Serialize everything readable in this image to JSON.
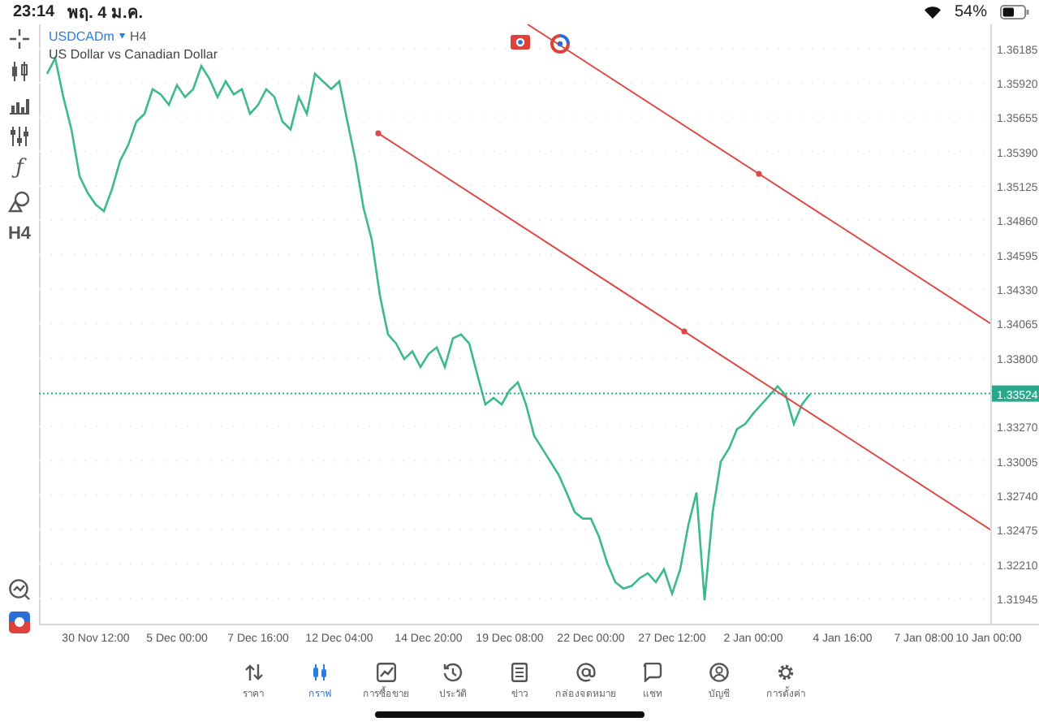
{
  "status_bar": {
    "time": "23:14",
    "date": "พฤ. 4 ม.ค.",
    "battery_text": "54%",
    "battery": {
      "level": 0.54
    }
  },
  "toolbar": {
    "function_label": "ƒ",
    "timeframe": "H4"
  },
  "chart_header": {
    "symbol": "USDCADm",
    "caret": "▾",
    "timeframe": "H4",
    "description": "US Dollar vs Canadian Dollar"
  },
  "chart": {
    "drawings": [
      {
        "kind": "trend_line"
      },
      {
        "kind": "trend_line"
      }
    ],
    "current_price": "1.33524",
    "chart_data": {
      "type": "line",
      "grid": true,
      "categories": [
        null,
        null,
        null,
        null,
        null,
        null,
        null,
        "30 Nov 12:00",
        null,
        null,
        null,
        null,
        null,
        null,
        null,
        null,
        null,
        "5 Dec 00:00",
        null,
        null,
        null,
        null,
        null,
        null,
        null,
        null,
        null,
        "7 Dec 16:00",
        null,
        null,
        null,
        null,
        null,
        null,
        null,
        null,
        null,
        "12 Dec 04:00",
        null,
        null,
        null,
        null,
        null,
        null,
        null,
        null,
        null,
        null,
        "14 Dec 20:00",
        null,
        null,
        null,
        null,
        null,
        null,
        null,
        null,
        null,
        "19 Dec 08:00",
        null,
        null,
        null,
        null,
        null,
        null,
        null,
        null,
        null,
        "22 Dec 00:00",
        null,
        null,
        null,
        null,
        null,
        null,
        null,
        null,
        null,
        "27 Dec 12:00",
        null,
        null,
        null,
        null,
        null,
        null,
        null,
        null,
        null,
        "2 Jan 00:00",
        null,
        null,
        null,
        null,
        null,
        null,
        null,
        null,
        null,
        null,
        "4 Jan 16:00",
        null,
        null,
        null,
        null,
        null,
        null,
        null,
        null,
        null,
        "7 Jan 08:00",
        null,
        null,
        null,
        null,
        null,
        null,
        null,
        "10 Jan 00:00"
      ],
      "series": [
        {
          "color": "#3dba8c",
          "values": [
            null,
            1.3599,
            1.3611,
            1.3581,
            1.3556,
            1.352,
            1.3507,
            1.3498,
            1.3493,
            1.351,
            1.3532,
            1.3544,
            1.3562,
            1.3568,
            1.3587,
            1.3583,
            1.3575,
            1.359,
            1.3581,
            1.3587,
            1.3605,
            1.3595,
            1.3581,
            1.3593,
            1.3583,
            1.3587,
            1.3568,
            1.3575,
            1.3587,
            1.3581,
            1.3562,
            1.3556,
            1.3581,
            1.3568,
            1.3599,
            1.3593,
            1.3587,
            1.3593,
            1.3562,
            1.3532,
            1.3495,
            1.3471,
            1.3428,
            1.3398,
            1.3391,
            1.3379,
            1.3385,
            1.3373,
            1.3383,
            1.3388,
            1.3373,
            1.3395,
            1.3398,
            1.3391,
            1.3367,
            1.3344,
            1.3349,
            1.3344,
            1.3355,
            1.3361,
            1.3344,
            1.332,
            1.331,
            1.33,
            1.329,
            1.3276,
            1.3261,
            1.3256,
            1.3256,
            1.3242,
            1.3222,
            1.3207,
            1.3202,
            1.3204,
            1.321,
            1.3214,
            1.3207,
            1.3217,
            1.3198,
            1.3217,
            1.3251,
            1.3276,
            1.3193,
            1.3261,
            1.33,
            1.331,
            1.3325,
            1.3329,
            1.3337,
            1.3344,
            1.3351,
            1.3358,
            1.3351,
            1.3329,
            1.3344,
            1.3352,
            null,
            null,
            null,
            null,
            null,
            null,
            null,
            null,
            null,
            null,
            null,
            null,
            null,
            null,
            null,
            null,
            null,
            null,
            null,
            null,
            null,
            null
          ]
        }
      ],
      "ylim": [
        1.3175,
        1.3637
      ],
      "yticks": [
        {
          "value": 1.36185,
          "label": "1.36185"
        },
        {
          "value": 1.3592,
          "label": "1.35920"
        },
        {
          "value": 1.35655,
          "label": "1.35655"
        },
        {
          "value": 1.3539,
          "label": "1.35390"
        },
        {
          "value": 1.35125,
          "label": "1.35125"
        },
        {
          "value": 1.3486,
          "label": "1.34860"
        },
        {
          "value": 1.34595,
          "label": "1.34595"
        },
        {
          "value": 1.3433,
          "label": "1.34330"
        },
        {
          "value": 1.34065,
          "label": "1.34065"
        },
        {
          "value": 1.338,
          "label": "1.33800"
        },
        {
          "value": 1.3327,
          "label": "1.33270"
        },
        {
          "value": 1.33005,
          "label": "1.33005"
        },
        {
          "value": 1.3274,
          "label": "1.32740"
        },
        {
          "value": 1.32475,
          "label": "1.32475"
        },
        {
          "value": 1.3221,
          "label": "1.32210"
        },
        {
          "value": 1.31945,
          "label": "1.31945"
        }
      ]
    }
  },
  "tabs": [
    {
      "label": "ราคา",
      "selected": false
    },
    {
      "label": "กราฟ",
      "selected": true
    },
    {
      "label": "การซื้อขาย",
      "selected": false
    },
    {
      "label": "ประวัติ",
      "selected": false
    },
    {
      "label": "ข่าว",
      "selected": false
    },
    {
      "label": "กล่องจดหมาย",
      "selected": false
    },
    {
      "label": "แชท",
      "selected": false
    },
    {
      "label": "บัญชี",
      "selected": false
    },
    {
      "label": "การตั้งค่า",
      "selected": false
    }
  ]
}
